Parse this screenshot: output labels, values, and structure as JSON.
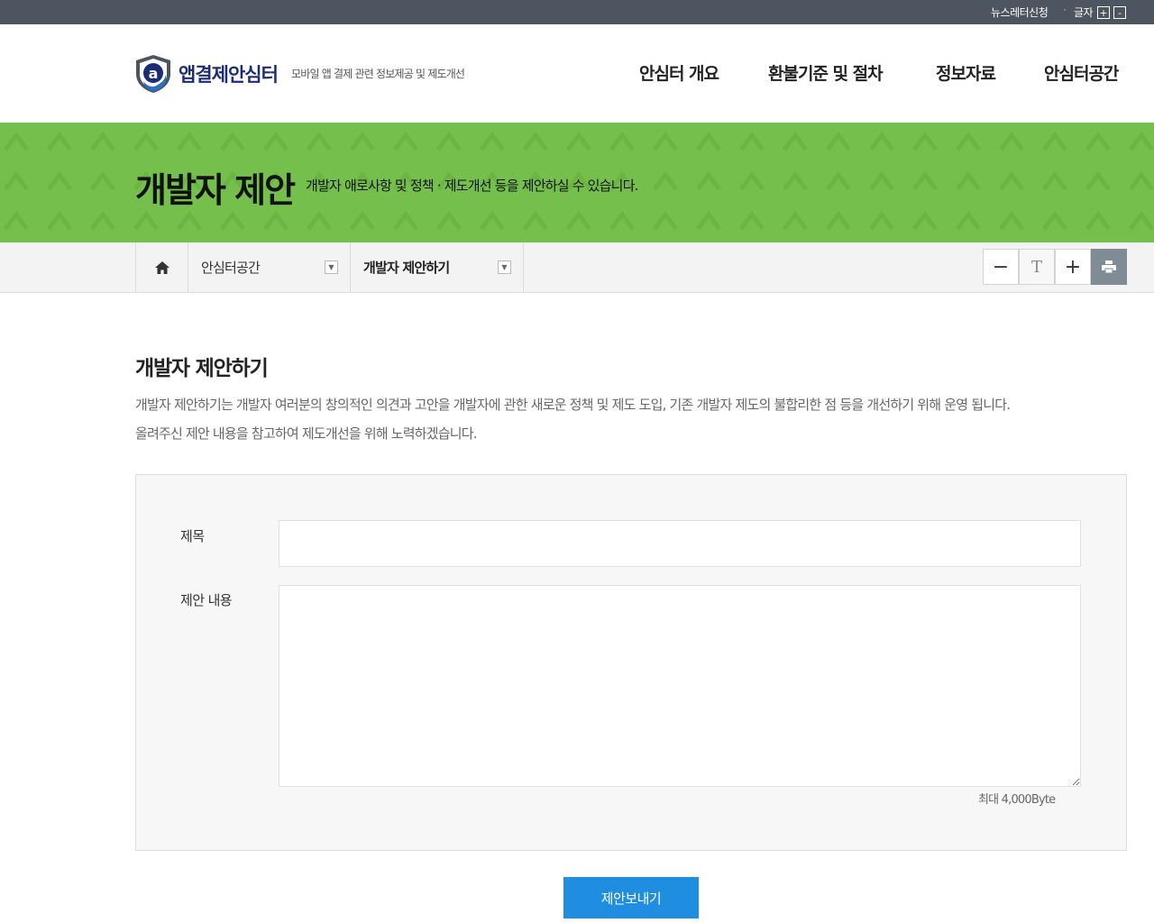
{
  "topbar": {
    "newsletter_label": "뉴스레터신청",
    "separator": "·",
    "font_size_label": "글자",
    "increase_label": "+",
    "decrease_label": "-"
  },
  "header": {
    "logo_name": "앱결제안심터",
    "logo_description": "모바일 앱 결제 관련 정보제공 및 제도개선",
    "nav": [
      {
        "label": "안심터 개요"
      },
      {
        "label": "환불기준 및 절차"
      },
      {
        "label": "정보자료"
      },
      {
        "label": "안심터공간"
      }
    ]
  },
  "banner": {
    "title": "개발자 제안",
    "subtitle": "개발자 애로사항 및 정책 · 제도개선 등을 제안하실 수 있습니다.",
    "color": "#75c04c"
  },
  "location": {
    "home_icon": "home-icon",
    "items": [
      {
        "label": "안심터공간"
      },
      {
        "label": "개발자 제안하기"
      }
    ],
    "tools": {
      "zoom_out": "−",
      "reset_text": "T",
      "zoom_in": "+",
      "print_icon": "print-icon"
    }
  },
  "content": {
    "title": "개발자 제안하기",
    "intro_line1": "개발자 제안하기는 개발자 여러분의 창의적인 의견과 고안을 개발자에 관한 새로운 정책 및 제도 도입, 기존 개발자 제도의 불합리한 점 등을 개선하기 위해 운영 됩니다.",
    "intro_line2": "올려주신 제안 내용을 참고하여 제도개선을 위해 노력하겠습니다."
  },
  "form": {
    "subject_label": "제목",
    "subject_value": "",
    "body_label": "제안 내용",
    "body_value": "",
    "max_note": "최대 4,000Byte",
    "submit_label": "제안보내기",
    "submit_color": "#1f8ee0"
  }
}
